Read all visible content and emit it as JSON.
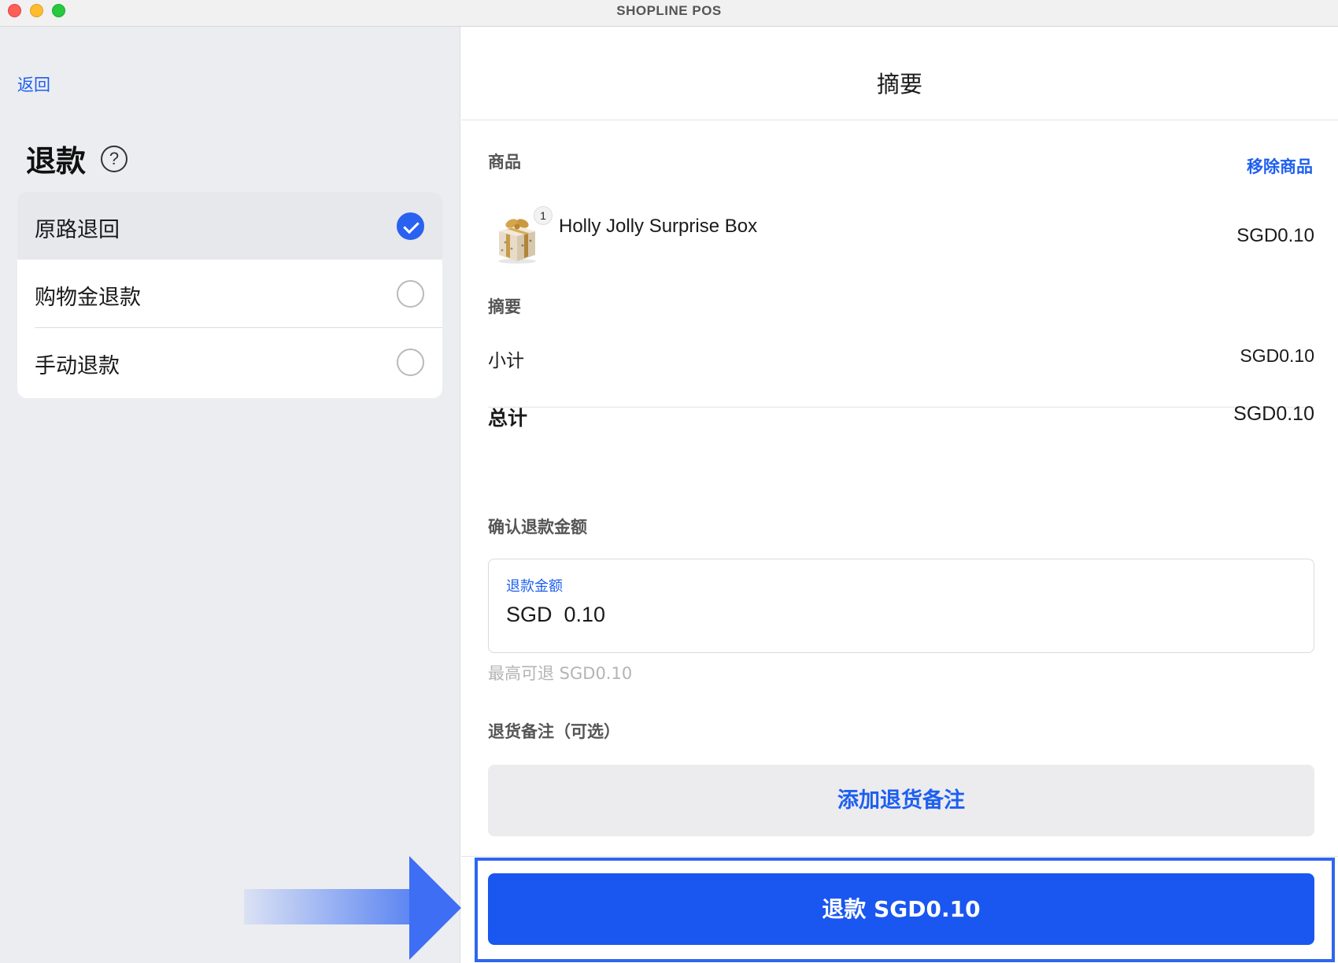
{
  "window": {
    "title": "SHOPLINE POS"
  },
  "left": {
    "back_label": "返回",
    "title": "退款",
    "help_glyph": "?",
    "options": [
      {
        "label": "原路退回",
        "selected": true
      },
      {
        "label": "购物金退款",
        "selected": false
      },
      {
        "label": "手动退款",
        "selected": false
      }
    ]
  },
  "right": {
    "title": "摘要",
    "products_section": {
      "label": "商品",
      "remove_label": "移除商品",
      "item": {
        "name": "Holly Jolly Surprise Box",
        "quantity": "1",
        "price": "SGD0.10",
        "image": "gift-box-image"
      }
    },
    "summary_section": {
      "label": "摘要",
      "subtotal_label": "小计",
      "subtotal_value": "SGD0.10",
      "total_label": "总计",
      "total_value": "SGD0.10"
    },
    "confirm_section": {
      "label": "确认退款金额",
      "field_label": "退款金额",
      "field_value": "SGD  0.10",
      "max_note": "最高可退 SGD0.10"
    },
    "note_section": {
      "label": "退货备注（可选）",
      "add_button": "添加退货备注"
    },
    "refund_button": "退款 SGD0.10"
  },
  "colors": {
    "accent": "#1a56f0",
    "link": "#1d5ff0",
    "left_bg": "#ecedf1"
  }
}
